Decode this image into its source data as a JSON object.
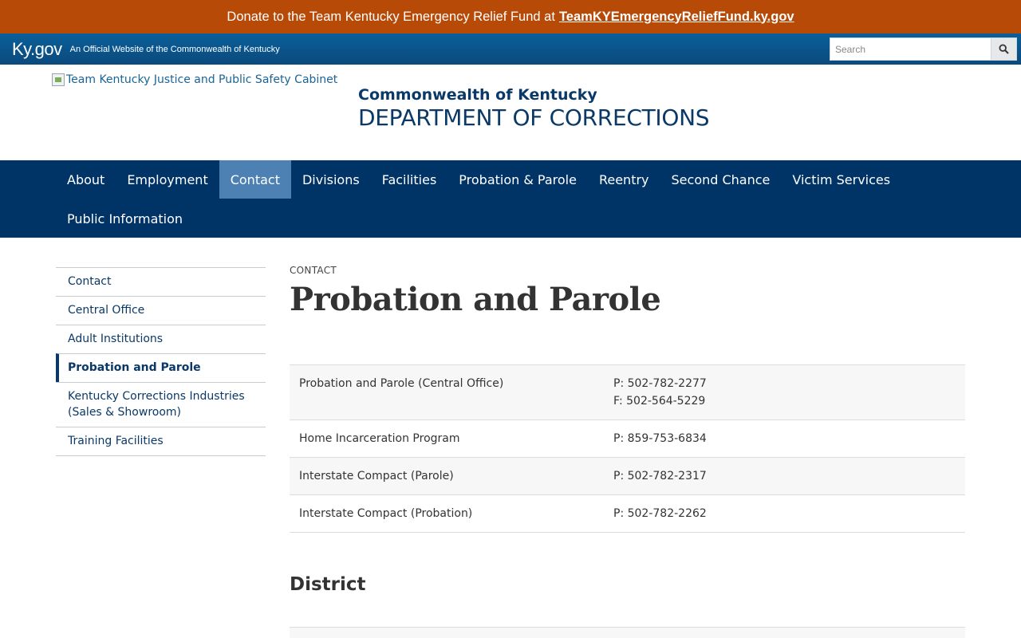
{
  "banner": {
    "text": "Donate to the Team Kentucky Emergency Relief Fund at",
    "link": "TeamKYEmergencyReliefFund.ky.gov"
  },
  "kybar": {
    "brand": "Ky.gov",
    "tagline": "An Official Website of the Commonwealth of Kentucky",
    "search_placeholder": "Search"
  },
  "header": {
    "logo_alt": "Team Kentucky Justice and Public Safety Cabinet",
    "subtitle": "Commonwealth of Kentucky",
    "title": "DEPARTMENT OF CORRECTIONS"
  },
  "nav": {
    "row1": [
      "About",
      "Employment",
      "Contact",
      "Divisions",
      "Facilities",
      "Probation & Parole",
      "Reentry",
      "Second Chance",
      "Victim Services"
    ],
    "row2": [
      "Public Information"
    ],
    "active": "Contact"
  },
  "sidenav": {
    "items": [
      "Contact",
      "Central Office",
      "Adult Institutions",
      "Probation and Parole",
      "Kentucky Corrections Industries (Sales & Showroom)",
      "Training Facilities"
    ],
    "active": "Probation and Parole"
  },
  "content": {
    "eyebrow": "CONTACT",
    "title": "Probation and Parole",
    "contacts": [
      {
        "name": "Probation and Parole (Central Office)",
        "phones": [
          "P: 502-782-2277",
          "F: 502-564-5229"
        ]
      },
      {
        "name": "Home Incarceration Program",
        "phones": [
          "P: 859-753-6834"
        ]
      },
      {
        "name": "Interstate Compact (Parole)",
        "phones": [
          "P: 502-782-2317"
        ]
      },
      {
        "name": "Interstate Compact (Probation)",
        "phones": [
          "P: 502-782-2262"
        ]
      }
    ],
    "district_heading": "District"
  },
  "colors": {
    "banner": "#b84a08",
    "navy": "#003366",
    "nav_active": "#4d80b3",
    "link": "#0a3968"
  }
}
